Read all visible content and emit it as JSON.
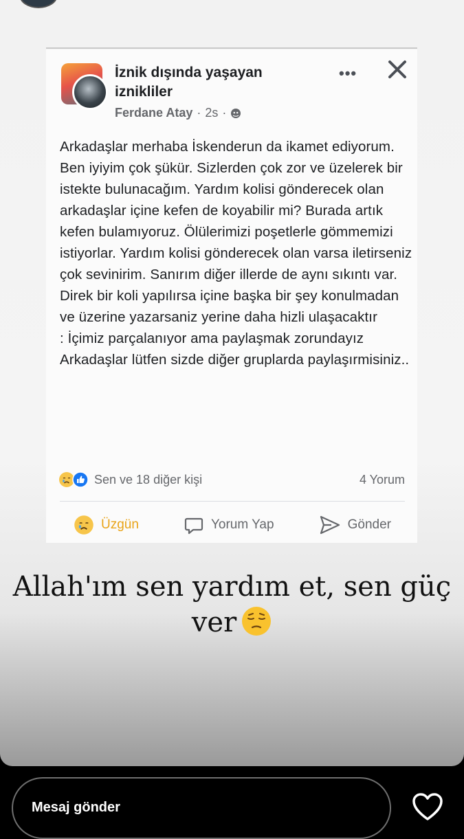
{
  "post": {
    "group_name": "İznik dışında yaşayan iznikliler",
    "author": "Ferdane Atay",
    "time": "2s",
    "body": "Arkadaşlar merhaba İskenderun da ikamet ediyorum. Ben iyiyim çok şükür. Sizlerden çok zor ve üzelerek bir istekte bulunacağım. Yardım kolisi gönderecek olan arkadaşlar içine kefen de koyabilir mi? Burada artık kefen bulamıyoruz. Ölülerimizi poşetlerle gömmemizi istiyorlar. Yardım kolisi gönderecek olan varsa iletirseniz çok sevinirim. Sanırım diğer illerde de aynı sıkıntı var. Direk bir koli yapılırsa içine başka bir şey konulmadan ve üzerine yazarsaniz yerine daha hizli ulaşacaktır\n: İçimiz parçalanıyor ama  paylaşmak zorundayız\nArkadaşlar lütfen sizde diğer gruplarda paylaşırmisiniz..",
    "reactions_text": "Sen ve 18 diğer kişi",
    "comments_text": "4 Yorum",
    "actions": {
      "sad": "Üzgün",
      "comment": "Yorum Yap",
      "send": "Gönder"
    }
  },
  "story": {
    "caption": "Allah'ım sen yardım et, sen güç ver",
    "caption_emoji": "pensive-face-icon",
    "message_placeholder": "Mesaj gönder"
  },
  "colors": {
    "sad_reaction": "#e9a317",
    "like_blue": "#1877f2",
    "meta_gray": "#65676b"
  }
}
